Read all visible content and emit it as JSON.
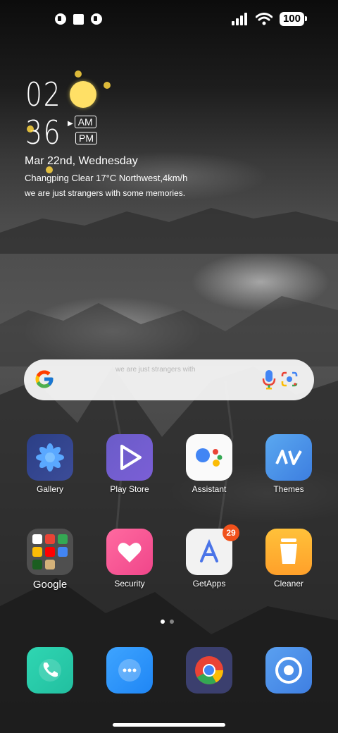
{
  "status_bar": {
    "battery": "100",
    "notifications": [
      "notification-icon",
      "square-notification-icon",
      "notification-icon"
    ]
  },
  "clock": {
    "hours": "02",
    "minutes": "36",
    "am": "AM",
    "pm": "PM"
  },
  "widget": {
    "date": "Mar 22nd, Wednesday",
    "weather": "Changping Clear 17°C Northwest,4km/h",
    "motto": "we are just strangers with some memories."
  },
  "search": {
    "faded_text": "we are just strangers with"
  },
  "apps_row1": [
    {
      "label": "Gallery",
      "icon": "gallery-icon"
    },
    {
      "label": "Play Store",
      "icon": "play-store-icon"
    },
    {
      "label": "Assistant",
      "icon": "assistant-icon"
    },
    {
      "label": "Themes",
      "icon": "themes-icon"
    }
  ],
  "apps_row2": [
    {
      "label": "Google",
      "icon": "google-folder-icon"
    },
    {
      "label": "Security",
      "icon": "security-icon"
    },
    {
      "label": "GetApps",
      "icon": "getapps-icon",
      "badge": "29"
    },
    {
      "label": "Cleaner",
      "icon": "cleaner-icon"
    }
  ],
  "dock": [
    "phone-icon",
    "messages-icon",
    "chrome-icon",
    "camera-icon"
  ],
  "page_indicator": {
    "pages": 2,
    "current": 1
  },
  "colors": {
    "badge": "#f1511b",
    "sun": "#ffe066"
  }
}
